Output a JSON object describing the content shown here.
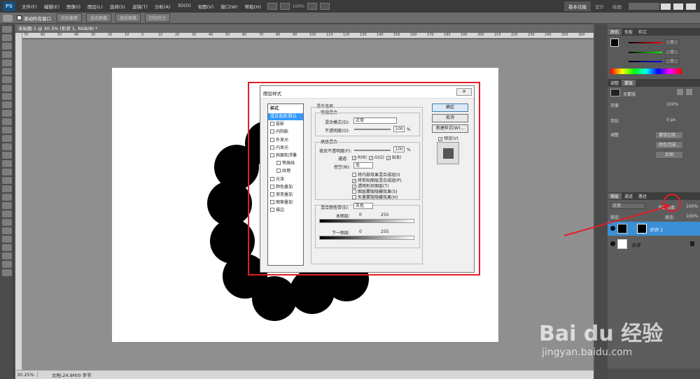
{
  "app": {
    "logo": "PS"
  },
  "menu": {
    "items": [
      "文件(F)",
      "编辑(E)",
      "图像(I)",
      "图层(L)",
      "选择(S)",
      "滤镜(T)",
      "分析(A)",
      "3D(D)",
      "视图(V)",
      "窗口(W)",
      "帮助(H)"
    ],
    "zoom": "100%",
    "workspaces": [
      "基本功能",
      "设计",
      "绘画"
    ]
  },
  "options": {
    "scroll_all": "滚动所有窗口",
    "buttons": [
      "实际像素",
      "适合屏幕",
      "填充屏幕",
      "打印尺寸"
    ]
  },
  "document": {
    "tab_title": "未标题-1 @ 30.3% (形状 1, RGB/8) *",
    "ruler_ticks": [
      "70",
      "60",
      "50",
      "40",
      "30",
      "20",
      "10",
      "0",
      "10",
      "20",
      "30",
      "40",
      "50",
      "60",
      "70",
      "80",
      "90",
      "100",
      "110",
      "120",
      "130",
      "140",
      "150",
      "160",
      "170",
      "180",
      "190",
      "200",
      "210",
      "220",
      "230",
      "240",
      "250",
      "260"
    ],
    "zoom": "30.25%",
    "doc_info": "文档:24.9M/0 字节"
  },
  "panels": {
    "color_tabs": [
      "颜色",
      "色板",
      "样式"
    ],
    "color_values": [
      "0",
      "0",
      "0"
    ],
    "adjust_tabs": [
      "调整",
      "蒙版"
    ],
    "mask_label": "无蒙版",
    "density_label": "浓度",
    "density_value": "100%",
    "feather_label": "羽化",
    "feather_value": "0 px",
    "refine_label": "调整",
    "mask_buttons": [
      "蒙版边缘...",
      "颜色范围...",
      "反相"
    ],
    "layers_tabs": [
      "图层",
      "通道",
      "路径"
    ],
    "blend_mode": "正常",
    "opacity_label": "不透明度:",
    "opacity_value": "100%",
    "lock_label": "锁定:",
    "fill_label": "填充:",
    "fill_value": "100%",
    "layers": [
      {
        "name": "形状 1"
      },
      {
        "name": "背景"
      }
    ]
  },
  "dialog": {
    "title": "图层样式",
    "close": "✕",
    "styles_header": "样式",
    "styles": [
      {
        "label": "混合选项:默认",
        "selected": true,
        "checkbox": false
      },
      {
        "label": "投影",
        "checkbox": true
      },
      {
        "label": "内阴影",
        "checkbox": true
      },
      {
        "label": "外发光",
        "checkbox": true
      },
      {
        "label": "内发光",
        "checkbox": true
      },
      {
        "label": "斜面和浮雕",
        "checkbox": true
      },
      {
        "label": "等高线",
        "checkbox": true,
        "sub": true
      },
      {
        "label": "纹理",
        "checkbox": true,
        "sub": true
      },
      {
        "label": "光泽",
        "checkbox": true
      },
      {
        "label": "颜色叠加",
        "checkbox": true
      },
      {
        "label": "渐变叠加",
        "checkbox": true
      },
      {
        "label": "图案叠加",
        "checkbox": true
      },
      {
        "label": "描边",
        "checkbox": true
      }
    ],
    "blend_options_title": "混合选项",
    "general_title": "常规混合",
    "blend_mode_label": "混合模式(D):",
    "blend_mode_value": "正常",
    "opacity_label": "不透明度(O):",
    "opacity_value": "100",
    "pct": "%",
    "advanced_title": "高级混合",
    "fill_opacity_label": "填充不透明度(F):",
    "fill_opacity_value": "100",
    "channels_label": "通道:",
    "channels": [
      "R(R)",
      "G(G)",
      "B(B)"
    ],
    "knockout_label": "挖空(N):",
    "knockout_value": "无",
    "advanced_checks": [
      {
        "label": "将内部效果混合成组(I)",
        "checked": false
      },
      {
        "label": "将剪贴图层混合成组(P)",
        "checked": true
      },
      {
        "label": "透明形状图层(T)",
        "checked": true
      },
      {
        "label": "图层蒙版隐藏效果(S)",
        "checked": false
      },
      {
        "label": "矢量蒙版隐藏效果(H)",
        "checked": false
      }
    ],
    "blend_if_label": "混合颜色带(E):",
    "blend_if_value": "灰色",
    "this_layer_label": "本图层:",
    "this_layer_min": "0",
    "this_layer_max": "255",
    "under_layer_label": "下一图层:",
    "under_layer_min": "0",
    "under_layer_max": "255",
    "buttons": {
      "ok": "确定",
      "cancel": "取消",
      "new_style": "新建样式(W)...",
      "preview": "预览(V)"
    }
  },
  "watermark": {
    "brand": "Bai du 经验",
    "url": "jingyan.baidu.com"
  },
  "colors": {
    "highlight": "#e21f26",
    "selection": "#3399ff",
    "layer_selection": "#3b8fd6"
  }
}
